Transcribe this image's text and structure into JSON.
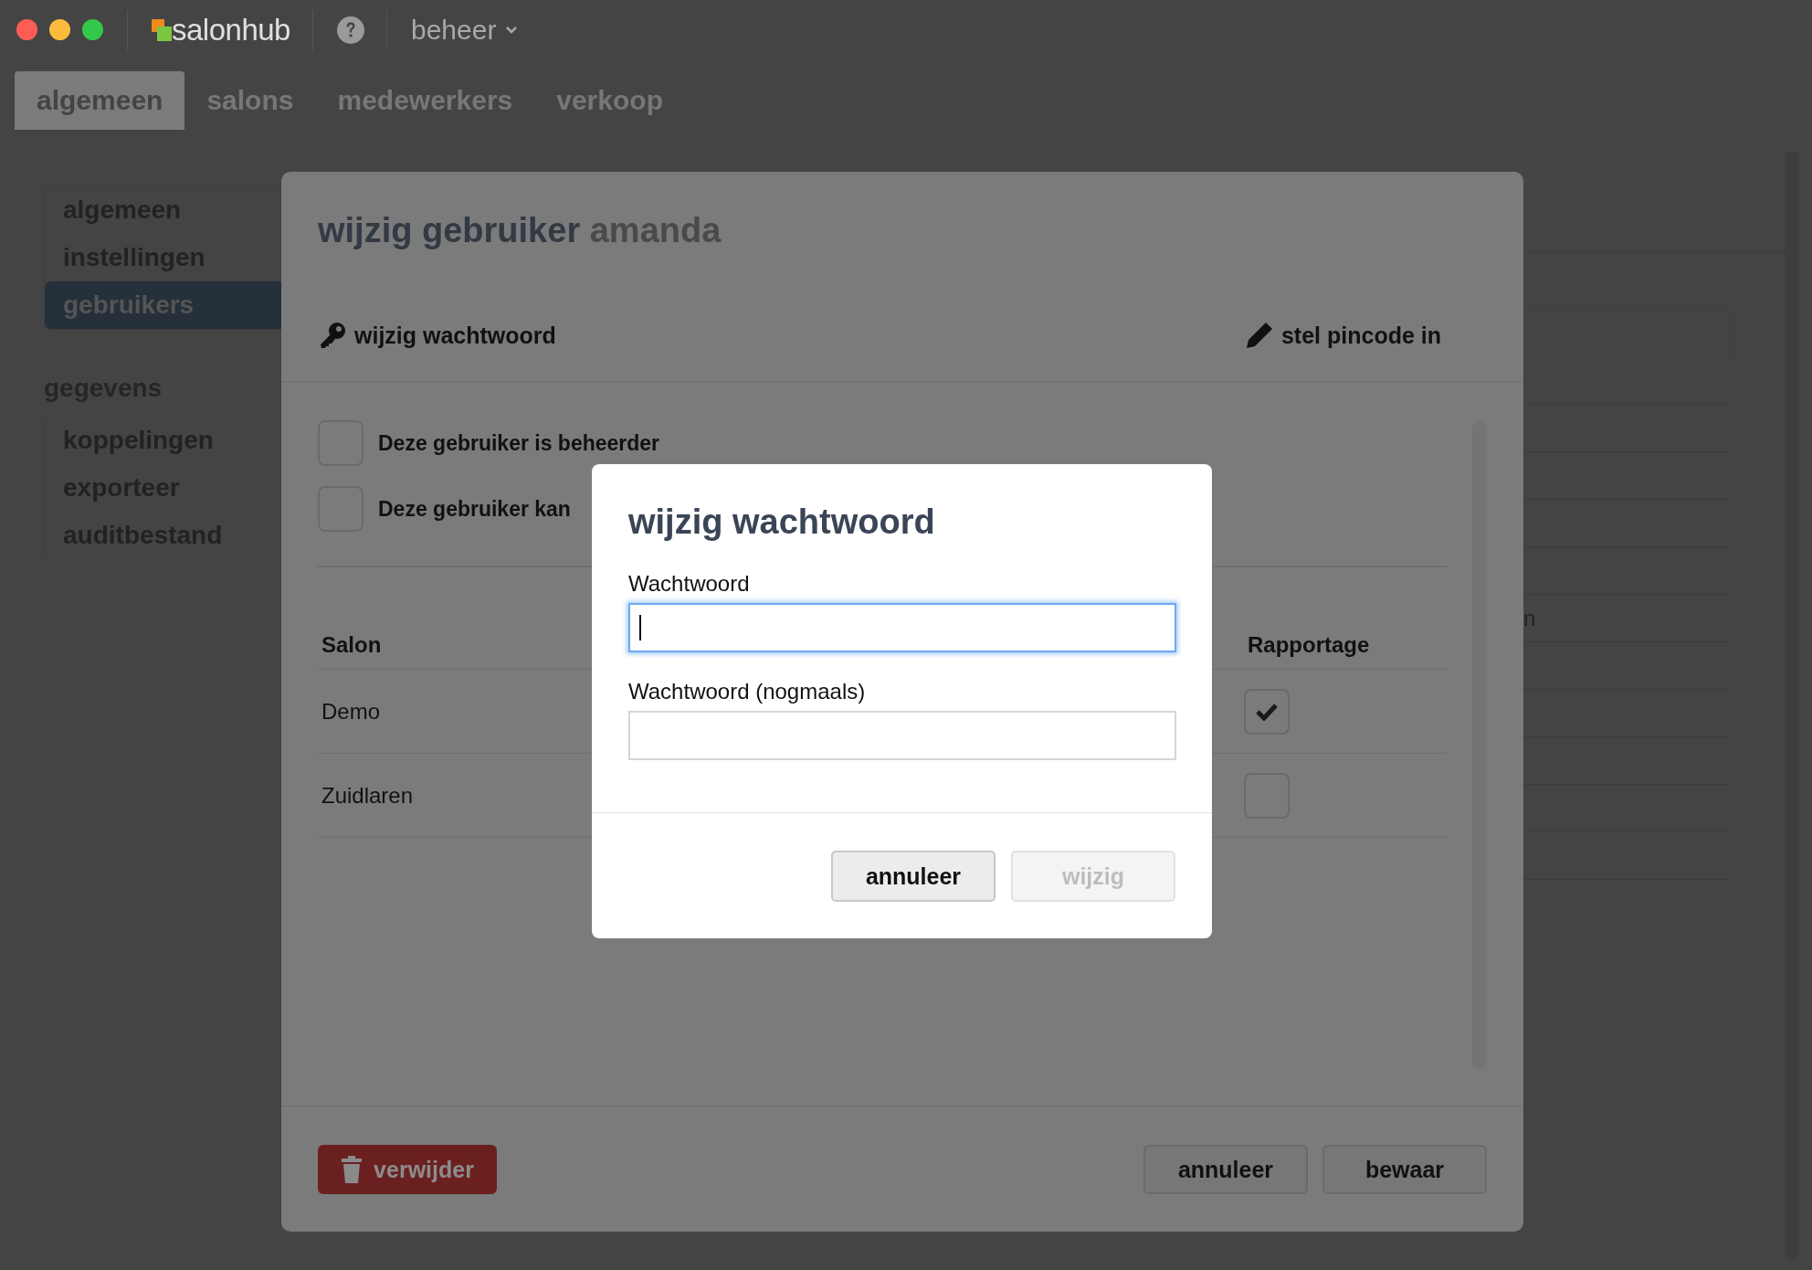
{
  "app": {
    "logo_text": "salonhub",
    "menu": "beheer"
  },
  "tabs": [
    {
      "label": "algemeen",
      "selected": true
    },
    {
      "label": "salons",
      "selected": false
    },
    {
      "label": "medewerkers",
      "selected": false
    },
    {
      "label": "verkoop",
      "selected": false
    }
  ],
  "sidebar": {
    "sections": [
      {
        "items": [
          {
            "label": "algemeen",
            "selected": false
          },
          {
            "label": "instellingen",
            "selected": false
          },
          {
            "label": "gebruikers",
            "selected": true
          }
        ]
      },
      {
        "heading": "gegevens",
        "items": [
          {
            "label": "koppelingen",
            "selected": false
          },
          {
            "label": "exporteer",
            "selected": false
          },
          {
            "label": "auditbestand",
            "selected": false
          }
        ]
      }
    ]
  },
  "background_table": {
    "visible_text": "n"
  },
  "edit_user_dialog": {
    "title": "wijzig gebruiker",
    "user": "amanda",
    "actions": [
      {
        "label": "wijzig wachtwoord",
        "kind": "key"
      },
      {
        "label": "stel pincode in",
        "kind": "pencil"
      }
    ],
    "options": [
      {
        "label": "Deze gebruiker is beheerder",
        "checked": false
      },
      {
        "label": "Deze gebruiker kan",
        "checked": false
      }
    ],
    "table": {
      "columns": [
        "Salon",
        "Rapportage"
      ],
      "rows": [
        {
          "salon": "Demo",
          "rapportage": true
        },
        {
          "salon": "Zuidlaren",
          "rapportage": false
        }
      ]
    },
    "buttons": [
      {
        "label": "verwijder",
        "kind": "danger"
      },
      {
        "label": "annuleer",
        "kind": "default"
      },
      {
        "label": "bewaar",
        "kind": "default"
      }
    ]
  },
  "password_dialog": {
    "title": "wijzig wachtwoord",
    "fields": [
      {
        "label": "Wachtwoord",
        "focused": true
      },
      {
        "label": "Wachtwoord (nogmaals)",
        "focused": false
      }
    ],
    "buttons": [
      {
        "label": "annuleer",
        "disabled": false
      },
      {
        "label": "wijzig",
        "disabled": true
      }
    ]
  }
}
